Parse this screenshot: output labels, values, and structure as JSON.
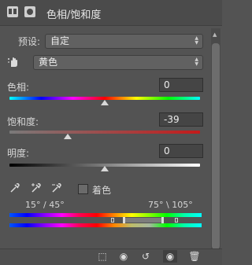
{
  "header": {
    "title": "色相/饱和度"
  },
  "preset": {
    "label": "预设:",
    "value": "自定"
  },
  "channel": {
    "value": "黄色"
  },
  "hue": {
    "label": "色相:",
    "value": "0",
    "level": 0.5
  },
  "saturation": {
    "label": "饱和度:",
    "value": "-39",
    "level": 0.305
  },
  "lightness": {
    "label": "明度:",
    "value": "0",
    "level": 0.5
  },
  "colorize": {
    "label": "着色",
    "checked": false
  },
  "range": {
    "left_label": "15° / 45°",
    "right_label": "75° \\ 105°"
  },
  "colors": {
    "background": "#535353",
    "saturation_track": "#c41a1a",
    "lightness_track_start": "#000000",
    "lightness_track_end": "#ffffff"
  },
  "icons": {
    "header": [
      "adjustment-layer-icon",
      "mask-icon"
    ],
    "tools": [
      "hand-target-icon",
      "eyedropper-icon",
      "eyedropper-plus-icon",
      "eyedropper-minus-icon"
    ],
    "footer": [
      "clip-to-layer-icon",
      "view-previous-icon",
      "reset-icon",
      "visibility-icon",
      "delete-icon"
    ]
  }
}
